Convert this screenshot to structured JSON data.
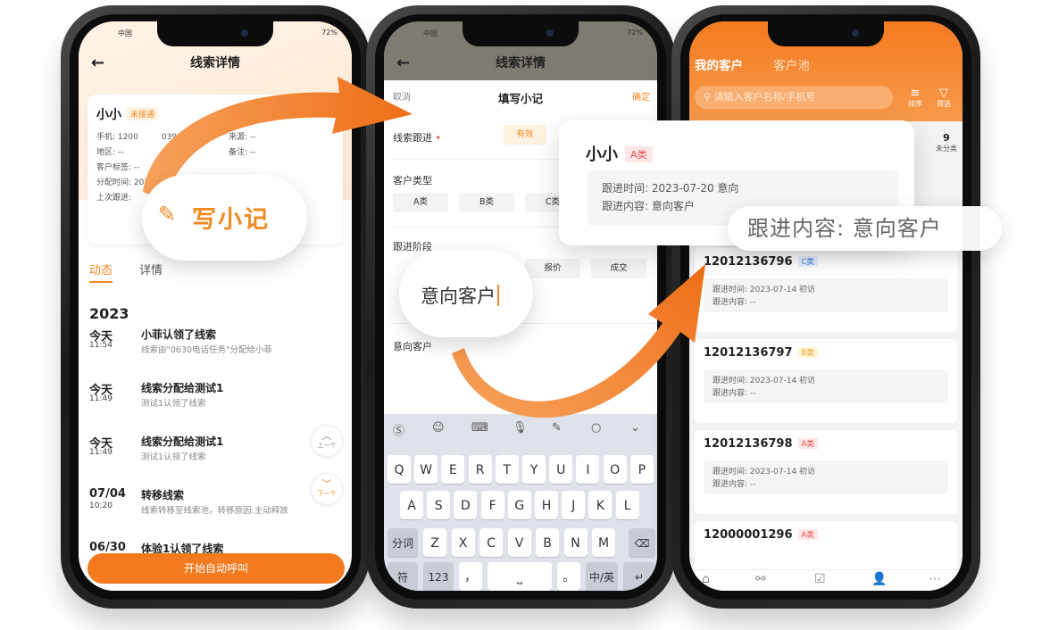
{
  "phone1": {
    "status_left": "中国",
    "status_right": "72%",
    "title": "线索详情",
    "lead": {
      "name": "小小",
      "badge": "未接通",
      "phone_label": "手机: 1200",
      "phone_suffix": "039",
      "source_label": "来源: --",
      "region_label": "地区: --",
      "remark_label": "备注: --",
      "tags_label": "客户标签: --",
      "assign_label": "分配时间: 2023",
      "last_label": "上次跟进:"
    },
    "tabs": [
      "动态",
      "详情"
    ],
    "year": "2023",
    "timeline": [
      {
        "date": "今天",
        "time": "11:54",
        "title": "小菲认领了线索",
        "sub": "线索由\"0630电话任务\"分配给小菲"
      },
      {
        "date": "今天",
        "time": "11:49",
        "title": "线索分配给测试1",
        "sub": "测试1认领了线索"
      },
      {
        "date": "今天",
        "time": "11:49",
        "title": "线索分配给测试1",
        "sub": "测试1认领了线索"
      },
      {
        "date": "07/04",
        "time": "10:20",
        "title": "转移线索",
        "sub": "线索转移至线索池，转移原因:主动释放"
      },
      {
        "date": "06/30",
        "time": "",
        "title": "体验1认领了线索",
        "sub": ""
      }
    ],
    "up_label": "上一个",
    "down_label": "下一个",
    "call_button": "开始自动呼叫"
  },
  "phone2": {
    "status_left": "中国",
    "status_right": "72%",
    "title": "线索详情",
    "sheet": {
      "cancel": "取消",
      "title": "填写小记",
      "confirm": "确定"
    },
    "follow_label": "线索跟进",
    "follow_options": [
      "有效"
    ],
    "type_label": "客户类型",
    "type_options": [
      "A类",
      "B类",
      "C类"
    ],
    "stage_label": "跟进阶段",
    "stage_options": [
      "报价",
      "成交"
    ],
    "note_text": "意向客户",
    "keyboard": {
      "row1": [
        "Q",
        "W",
        "E",
        "R",
        "T",
        "Y",
        "U",
        "I",
        "O",
        "P"
      ],
      "row2": [
        "A",
        "S",
        "D",
        "F",
        "G",
        "H",
        "J",
        "K",
        "L"
      ],
      "row3": [
        "Z",
        "X",
        "C",
        "V",
        "B",
        "N",
        "M"
      ],
      "segment": "分词",
      "symbol": "符",
      "num": "123",
      "comma": "，",
      "period": "。",
      "lang": "中/英"
    }
  },
  "phone3": {
    "tabs": [
      "我的客户",
      "客户池"
    ],
    "search_placeholder": "请输入客户名称/手机号",
    "sort_label": "排序",
    "filter_label": "筛选",
    "stat_value": "9",
    "stat_label": "未分类",
    "customers": [
      {
        "phone": "12012136796",
        "tag": "C类",
        "time": "跟进时间: 2023-07-14 初访",
        "content": "跟进内容: --"
      },
      {
        "phone": "12012136797",
        "tag": "B类",
        "time": "跟进时间: 2023-07-14 初访",
        "content": "跟进内容: --"
      },
      {
        "phone": "12012136798",
        "tag": "A类",
        "time": "跟进时间: 2023-07-14 初访",
        "content": "跟进内容: --"
      },
      {
        "phone": "12000001296",
        "tag": "A类",
        "time": "",
        "content": ""
      }
    ]
  },
  "overlays": {
    "write_note": "写小记",
    "typed_intent": "意向客户",
    "popup": {
      "name": "小小",
      "tag": "A类",
      "time": "跟进时间: 2023-07-20 意向",
      "content": "跟进内容: 意向客户"
    },
    "highlight": "跟进内容: 意向客户"
  },
  "colors": {
    "accent": "#f47a1f",
    "tag_red": "#e54b4b",
    "tag_blue": "#3a7be0",
    "tag_yellow": "#e6a017"
  }
}
